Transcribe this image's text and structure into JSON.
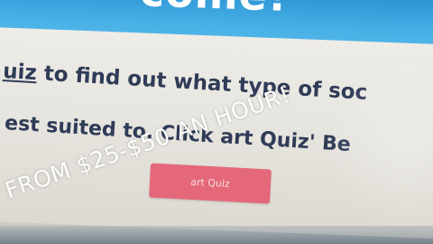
{
  "screen": {
    "headline": "come!",
    "line1_link": "uiz",
    "line1_rest": " to find out what type of soc",
    "line2": "est suited to. Click  art Quiz' Be",
    "start_button_label": "art Quiz"
  },
  "overlay": {
    "caption": "FROM $25-$50 AN HOUR!"
  },
  "colors": {
    "header_blue": "#3aa6e0",
    "text_navy": "#2f3b57",
    "button_pink": "#e4687a"
  }
}
